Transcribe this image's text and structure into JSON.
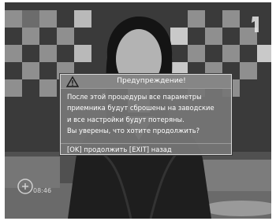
{
  "dialog": {
    "title": "Предупреждение!",
    "icon": "warning-triangle-icon",
    "lines": [
      "После этой процедуры все параметры",
      "приемника будут сброшены на заводские",
      "и все настройки будут потеряны.",
      "Вы уверены, что хотите продолжить?"
    ],
    "footer": "[OK] продолжить [EXIT] назад"
  },
  "overlay": {
    "clock": "08:46",
    "channel_logo_icon": "channel-one-logo-icon"
  }
}
